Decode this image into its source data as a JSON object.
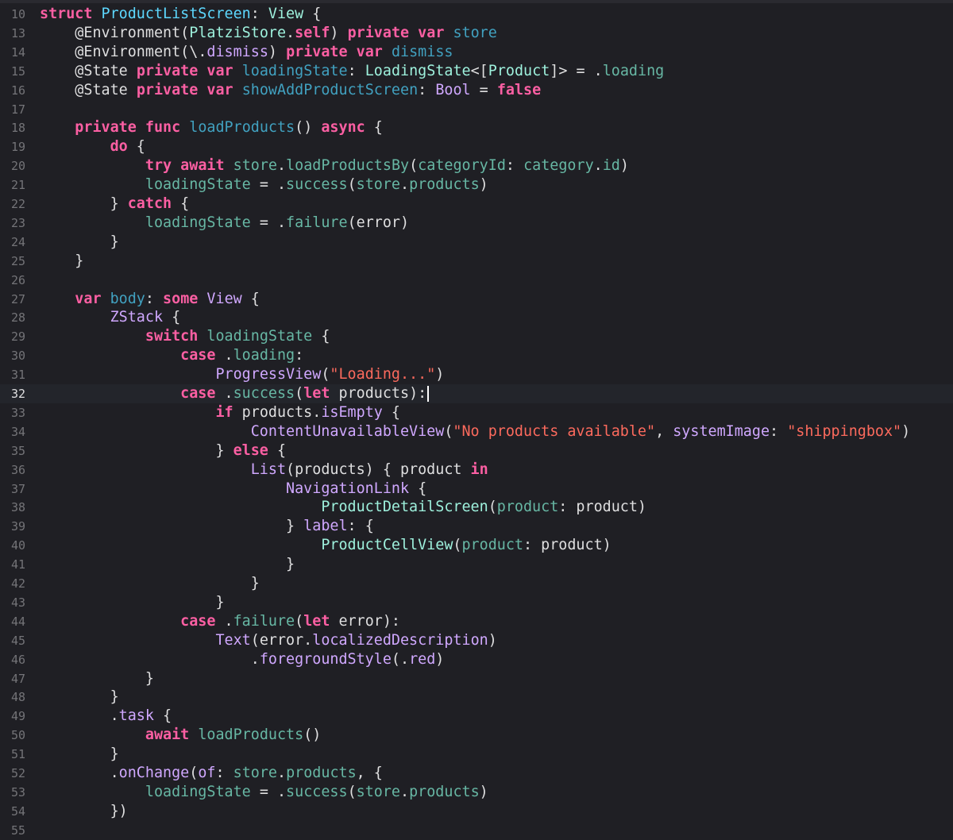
{
  "editor": {
    "current_line": "32",
    "lines": [
      {
        "n": "10",
        "t": [
          [
            "kw",
            "struct"
          ],
          [
            "plain",
            " "
          ],
          [
            "type",
            "ProductListScreen"
          ],
          [
            "plain",
            ": "
          ],
          [
            "cls",
            "View"
          ],
          [
            "plain",
            " {"
          ]
        ]
      },
      {
        "n": "13",
        "t": [
          [
            "plain",
            "    "
          ],
          [
            "attr",
            "@Environment"
          ],
          [
            "plain",
            "("
          ],
          [
            "cls",
            "PlatziStore"
          ],
          [
            "plain",
            "."
          ],
          [
            "kw",
            "self"
          ],
          [
            "plain",
            ") "
          ],
          [
            "kw",
            "private"
          ],
          [
            "plain",
            " "
          ],
          [
            "kw",
            "var"
          ],
          [
            "plain",
            " "
          ],
          [
            "decl",
            "store"
          ]
        ]
      },
      {
        "n": "14",
        "t": [
          [
            "plain",
            "    "
          ],
          [
            "attr",
            "@Environment"
          ],
          [
            "plain",
            "(\\."
          ],
          [
            "sys",
            "dismiss"
          ],
          [
            "plain",
            ") "
          ],
          [
            "kw",
            "private"
          ],
          [
            "plain",
            " "
          ],
          [
            "kw",
            "var"
          ],
          [
            "plain",
            " "
          ],
          [
            "decl",
            "dismiss"
          ]
        ]
      },
      {
        "n": "15",
        "t": [
          [
            "plain",
            "    "
          ],
          [
            "attr",
            "@State"
          ],
          [
            "plain",
            " "
          ],
          [
            "kw",
            "private"
          ],
          [
            "plain",
            " "
          ],
          [
            "kw",
            "var"
          ],
          [
            "plain",
            " "
          ],
          [
            "decl",
            "loadingState"
          ],
          [
            "plain",
            ": "
          ],
          [
            "cls",
            "LoadingState"
          ],
          [
            "plain",
            "<["
          ],
          [
            "cls",
            "Product"
          ],
          [
            "plain",
            "]> = ."
          ],
          [
            "mem",
            "loading"
          ]
        ]
      },
      {
        "n": "16",
        "t": [
          [
            "plain",
            "    "
          ],
          [
            "attr",
            "@State"
          ],
          [
            "plain",
            " "
          ],
          [
            "kw",
            "private"
          ],
          [
            "plain",
            " "
          ],
          [
            "kw",
            "var"
          ],
          [
            "plain",
            " "
          ],
          [
            "decl",
            "showAddProductScreen"
          ],
          [
            "plain",
            ": "
          ],
          [
            "sys",
            "Bool"
          ],
          [
            "plain",
            " = "
          ],
          [
            "kw",
            "false"
          ]
        ]
      },
      {
        "n": "17",
        "t": []
      },
      {
        "n": "18",
        "t": [
          [
            "plain",
            "    "
          ],
          [
            "kw",
            "private"
          ],
          [
            "plain",
            " "
          ],
          [
            "kw",
            "func"
          ],
          [
            "plain",
            " "
          ],
          [
            "decl",
            "loadProducts"
          ],
          [
            "plain",
            "() "
          ],
          [
            "kw",
            "async"
          ],
          [
            "plain",
            " {"
          ]
        ]
      },
      {
        "n": "19",
        "t": [
          [
            "plain",
            "        "
          ],
          [
            "kw",
            "do"
          ],
          [
            "plain",
            " {"
          ]
        ]
      },
      {
        "n": "20",
        "t": [
          [
            "plain",
            "            "
          ],
          [
            "kw",
            "try"
          ],
          [
            "plain",
            " "
          ],
          [
            "kw",
            "await"
          ],
          [
            "plain",
            " "
          ],
          [
            "mem",
            "store"
          ],
          [
            "plain",
            "."
          ],
          [
            "mem",
            "loadProductsBy"
          ],
          [
            "plain",
            "("
          ],
          [
            "mem",
            "categoryId"
          ],
          [
            "plain",
            ": "
          ],
          [
            "mem",
            "category"
          ],
          [
            "plain",
            "."
          ],
          [
            "mem",
            "id"
          ],
          [
            "plain",
            ")"
          ]
        ]
      },
      {
        "n": "21",
        "t": [
          [
            "plain",
            "            "
          ],
          [
            "mem",
            "loadingState"
          ],
          [
            "plain",
            " = ."
          ],
          [
            "mem",
            "success"
          ],
          [
            "plain",
            "("
          ],
          [
            "mem",
            "store"
          ],
          [
            "plain",
            "."
          ],
          [
            "mem",
            "products"
          ],
          [
            "plain",
            ")"
          ]
        ]
      },
      {
        "n": "22",
        "t": [
          [
            "plain",
            "        } "
          ],
          [
            "kw",
            "catch"
          ],
          [
            "plain",
            " {"
          ]
        ]
      },
      {
        "n": "23",
        "t": [
          [
            "plain",
            "            "
          ],
          [
            "mem",
            "loadingState"
          ],
          [
            "plain",
            " = ."
          ],
          [
            "mem",
            "failure"
          ],
          [
            "plain",
            "(error)"
          ]
        ]
      },
      {
        "n": "24",
        "t": [
          [
            "plain",
            "        }"
          ]
        ]
      },
      {
        "n": "25",
        "t": [
          [
            "plain",
            "    }"
          ]
        ]
      },
      {
        "n": "26",
        "t": []
      },
      {
        "n": "27",
        "t": [
          [
            "plain",
            "    "
          ],
          [
            "kw",
            "var"
          ],
          [
            "plain",
            " "
          ],
          [
            "decl",
            "body"
          ],
          [
            "plain",
            ": "
          ],
          [
            "kw",
            "some"
          ],
          [
            "plain",
            " "
          ],
          [
            "sys",
            "View"
          ],
          [
            "plain",
            " {"
          ]
        ]
      },
      {
        "n": "28",
        "t": [
          [
            "plain",
            "        "
          ],
          [
            "sys",
            "ZStack"
          ],
          [
            "plain",
            " {"
          ]
        ]
      },
      {
        "n": "29",
        "t": [
          [
            "plain",
            "            "
          ],
          [
            "kw",
            "switch"
          ],
          [
            "plain",
            " "
          ],
          [
            "mem",
            "loadingState"
          ],
          [
            "plain",
            " {"
          ]
        ]
      },
      {
        "n": "30",
        "t": [
          [
            "plain",
            "                "
          ],
          [
            "kw",
            "case"
          ],
          [
            "plain",
            " ."
          ],
          [
            "mem",
            "loading"
          ],
          [
            "plain",
            ":"
          ]
        ]
      },
      {
        "n": "31",
        "t": [
          [
            "plain",
            "                    "
          ],
          [
            "sys",
            "ProgressView"
          ],
          [
            "plain",
            "("
          ],
          [
            "str",
            "\"Loading...\""
          ],
          [
            "plain",
            ")"
          ]
        ]
      },
      {
        "n": "32",
        "t": [
          [
            "plain",
            "                "
          ],
          [
            "kw",
            "case"
          ],
          [
            "plain",
            " ."
          ],
          [
            "mem",
            "success"
          ],
          [
            "plain",
            "("
          ],
          [
            "kw",
            "let"
          ],
          [
            "plain",
            " products):"
          ]
        ],
        "caret": true
      },
      {
        "n": "33",
        "t": [
          [
            "plain",
            "                    "
          ],
          [
            "kw",
            "if"
          ],
          [
            "plain",
            " products."
          ],
          [
            "sys",
            "isEmpty"
          ],
          [
            "plain",
            " {"
          ]
        ]
      },
      {
        "n": "34",
        "t": [
          [
            "plain",
            "                        "
          ],
          [
            "sys",
            "ContentUnavailableView"
          ],
          [
            "plain",
            "("
          ],
          [
            "str",
            "\"No products available\""
          ],
          [
            "plain",
            ", "
          ],
          [
            "sys",
            "systemImage"
          ],
          [
            "plain",
            ": "
          ],
          [
            "str",
            "\"shippingbox\""
          ],
          [
            "plain",
            ")"
          ]
        ]
      },
      {
        "n": "35",
        "t": [
          [
            "plain",
            "                    } "
          ],
          [
            "kw",
            "else"
          ],
          [
            "plain",
            " {"
          ]
        ]
      },
      {
        "n": "36",
        "t": [
          [
            "plain",
            "                        "
          ],
          [
            "sys",
            "List"
          ],
          [
            "plain",
            "(products) { product "
          ],
          [
            "kw",
            "in"
          ]
        ]
      },
      {
        "n": "37",
        "t": [
          [
            "plain",
            "                            "
          ],
          [
            "sys",
            "NavigationLink"
          ],
          [
            "plain",
            " {"
          ]
        ]
      },
      {
        "n": "38",
        "t": [
          [
            "plain",
            "                                "
          ],
          [
            "cls",
            "ProductDetailScreen"
          ],
          [
            "plain",
            "("
          ],
          [
            "mem",
            "product"
          ],
          [
            "plain",
            ": product)"
          ]
        ]
      },
      {
        "n": "39",
        "t": [
          [
            "plain",
            "                            } "
          ],
          [
            "sys",
            "label"
          ],
          [
            "plain",
            ": {"
          ]
        ]
      },
      {
        "n": "40",
        "t": [
          [
            "plain",
            "                                "
          ],
          [
            "cls",
            "ProductCellView"
          ],
          [
            "plain",
            "("
          ],
          [
            "mem",
            "product"
          ],
          [
            "plain",
            ": product)"
          ]
        ]
      },
      {
        "n": "41",
        "t": [
          [
            "plain",
            "                            }"
          ]
        ]
      },
      {
        "n": "42",
        "t": [
          [
            "plain",
            "                        }"
          ]
        ]
      },
      {
        "n": "43",
        "t": [
          [
            "plain",
            "                    }"
          ]
        ]
      },
      {
        "n": "44",
        "t": [
          [
            "plain",
            "                "
          ],
          [
            "kw",
            "case"
          ],
          [
            "plain",
            " ."
          ],
          [
            "mem",
            "failure"
          ],
          [
            "plain",
            "("
          ],
          [
            "kw",
            "let"
          ],
          [
            "plain",
            " error):"
          ]
        ]
      },
      {
        "n": "45",
        "t": [
          [
            "plain",
            "                    "
          ],
          [
            "sys",
            "Text"
          ],
          [
            "plain",
            "(error."
          ],
          [
            "sys",
            "localizedDescription"
          ],
          [
            "plain",
            ")"
          ]
        ]
      },
      {
        "n": "46",
        "t": [
          [
            "plain",
            "                        ."
          ],
          [
            "sys",
            "foregroundStyle"
          ],
          [
            "plain",
            "(."
          ],
          [
            "sys",
            "red"
          ],
          [
            "plain",
            ")"
          ]
        ]
      },
      {
        "n": "47",
        "t": [
          [
            "plain",
            "            }"
          ]
        ]
      },
      {
        "n": "48",
        "t": [
          [
            "plain",
            "        }"
          ]
        ]
      },
      {
        "n": "49",
        "t": [
          [
            "plain",
            "        ."
          ],
          [
            "sys",
            "task"
          ],
          [
            "plain",
            " {"
          ]
        ]
      },
      {
        "n": "50",
        "t": [
          [
            "plain",
            "            "
          ],
          [
            "kw",
            "await"
          ],
          [
            "plain",
            " "
          ],
          [
            "mem",
            "loadProducts"
          ],
          [
            "plain",
            "()"
          ]
        ]
      },
      {
        "n": "51",
        "t": [
          [
            "plain",
            "        }"
          ]
        ]
      },
      {
        "n": "52",
        "t": [
          [
            "plain",
            "        ."
          ],
          [
            "sys",
            "onChange"
          ],
          [
            "plain",
            "("
          ],
          [
            "sys",
            "of"
          ],
          [
            "plain",
            ": "
          ],
          [
            "mem",
            "store"
          ],
          [
            "plain",
            "."
          ],
          [
            "mem",
            "products"
          ],
          [
            "plain",
            ", {"
          ]
        ]
      },
      {
        "n": "53",
        "t": [
          [
            "plain",
            "            "
          ],
          [
            "mem",
            "loadingState"
          ],
          [
            "plain",
            " = ."
          ],
          [
            "mem",
            "success"
          ],
          [
            "plain",
            "("
          ],
          [
            "mem",
            "store"
          ],
          [
            "plain",
            "."
          ],
          [
            "mem",
            "products"
          ],
          [
            "plain",
            ")"
          ]
        ]
      },
      {
        "n": "54",
        "t": [
          [
            "plain",
            "        })"
          ]
        ]
      },
      {
        "n": "55",
        "t": []
      }
    ]
  },
  "colors": {
    "background": "#1f1f24",
    "current_line": "#23252b",
    "keyword": "#fc5fa3",
    "type_declaration": "#5dd8ff",
    "project_type": "#9ef1dd",
    "project_member": "#67b7a4",
    "system_symbol": "#d0a8ff",
    "string": "#fc6a5d",
    "plain": "#dfdfe0",
    "line_number": "#747478"
  }
}
